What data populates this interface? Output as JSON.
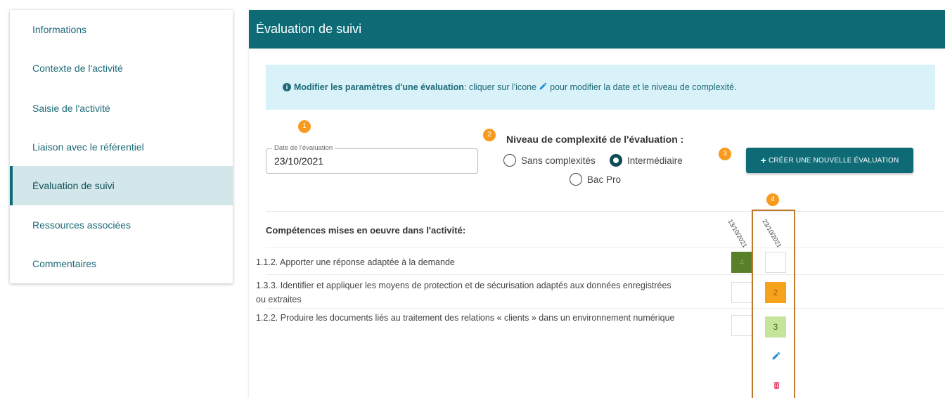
{
  "sidebar": {
    "items": [
      {
        "label": "Informations",
        "active": false
      },
      {
        "label": "Contexte de l'activité",
        "active": false
      },
      {
        "label": "Saisie de l'activité",
        "active": false
      },
      {
        "label": "Liaison avec le référentiel",
        "active": false
      },
      {
        "label": "Évaluation de suivi",
        "active": true
      },
      {
        "label": "Ressources associées",
        "active": false
      },
      {
        "label": "Commentaires",
        "active": false
      }
    ]
  },
  "panel": {
    "title": "Évaluation de suivi",
    "info": {
      "bold": "Modifier les paramètres d'une évaluation",
      "text_before_icon": " : cliquer sur l'icone",
      "text_after_icon": " pour modifier la date et le niveau de complexité."
    },
    "badges": [
      "1",
      "2",
      "3",
      "4"
    ],
    "date_field": {
      "label": "Date de l'évaluation",
      "value": "23/10/2021"
    },
    "niveau": {
      "title": "Niveau de complexité de l'évaluation :",
      "options": [
        {
          "label": "Sans complexités",
          "checked": false
        },
        {
          "label": "Intermédiaire",
          "checked": true
        },
        {
          "label": "Bac Pro",
          "checked": false
        }
      ]
    },
    "create_button": "CRÉER UNE NOUVELLE ÉVALUATION",
    "competences": {
      "header": "Compétences mises en oeuvre dans l'activité:",
      "dates": [
        "13/10/2021",
        "23/10/2021"
      ],
      "rows": [
        {
          "text": "1.1.2. Apporter une réponse adaptée à la demande",
          "scores": [
            "4",
            ""
          ]
        },
        {
          "text": "1.3.3. Identifier et appliquer les moyens de protection et de sécurisation adaptés aux données enregistrées ou extraites",
          "scores": [
            "",
            "2"
          ]
        },
        {
          "text": "1.2.2. Produire les documents liés au traitement des relations « clients » dans un environnement numérique",
          "scores": [
            "",
            "3"
          ]
        }
      ]
    }
  },
  "colors": {
    "primary": "#0e6b76",
    "badge": "#f79a1d",
    "score_4": "#5a7f2a",
    "score_2": "#f7a21b",
    "score_3": "#c7e59a",
    "edit_icon": "#1e8fd6",
    "delete_icon": "#e8365d",
    "highlight_border": "#c07a2d"
  }
}
